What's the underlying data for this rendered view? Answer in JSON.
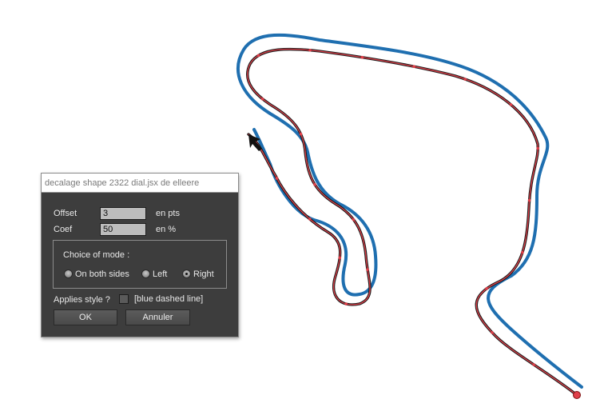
{
  "dialog": {
    "title": "decalage shape 2322 dial.jsx de elleere",
    "offset": {
      "label": "Offset",
      "value": "3",
      "unit": "en pts"
    },
    "coef": {
      "label": "Coef",
      "value": "50",
      "unit": "en %"
    },
    "mode_group": {
      "title": "Choice of mode :",
      "options": [
        {
          "label": "On both sides",
          "selected": false
        },
        {
          "label": "Left",
          "selected": false
        },
        {
          "label": "Right",
          "selected": true
        }
      ]
    },
    "applies_style": {
      "label": "Applies style ?",
      "checked": false,
      "option_label": "[blue dashed line]"
    },
    "ok_label": "OK",
    "cancel_label": "Annuler"
  },
  "artwork": {
    "path_color": "#1a1a1a",
    "offset_color": "#1f6fb0",
    "anchor_color": "#e0404a"
  }
}
